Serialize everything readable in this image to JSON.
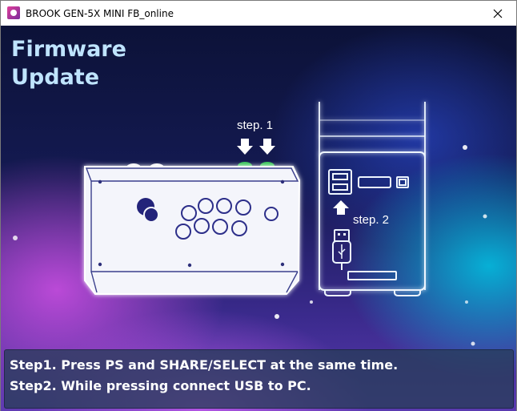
{
  "window": {
    "title": "BROOK GEN-5X MINI FB_online",
    "icon": "brook-app-icon",
    "close_icon": "close-icon"
  },
  "main": {
    "heading_line1": "Firmware",
    "heading_line2": "Update",
    "step1_label": "step. 1",
    "step2_label": "step. 2"
  },
  "instructions": {
    "line1": "Step1. Press PS and SHARE/SELECT at the same time.",
    "line2": "Step2. While pressing connect USB to PC."
  },
  "colors": {
    "heading": "#bfe4ff",
    "panel_bg": "#283c5a",
    "glow": "#ffffff",
    "green_buttons": "#2fb24a"
  }
}
